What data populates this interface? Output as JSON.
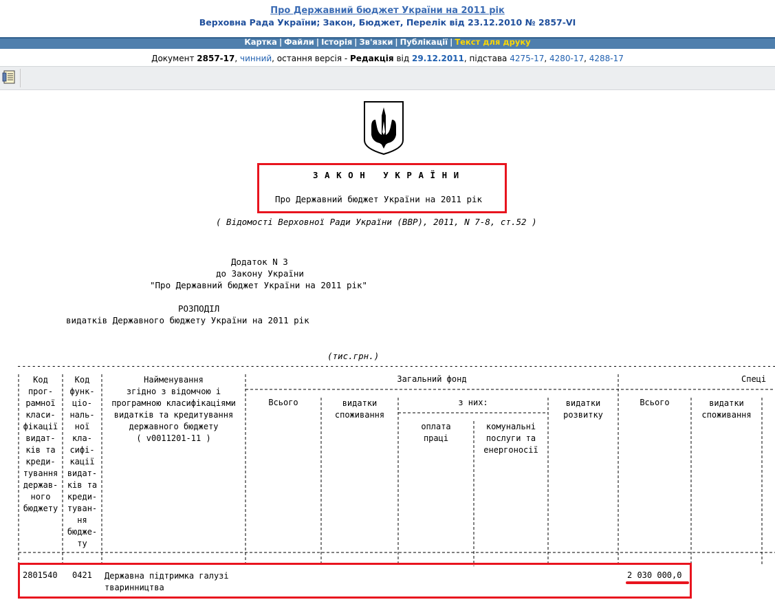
{
  "header": {
    "title_link": "Про Державний бюджет України на 2011 рік",
    "subtitle": "Верховна Рада України; Закон, Бюджет, Перелік від 23.12.2010 № 2857-VI"
  },
  "nav": {
    "items": [
      "Картка",
      "Файли",
      "Історія",
      "Зв'язки",
      "Публікації",
      "Текст для друку"
    ],
    "separator": "|"
  },
  "docline": {
    "prefix": "Документ",
    "number": "2857-17",
    "status": "чинний",
    "middle": ", остання версія -",
    "redaction_label": "Редакція",
    "from": "від",
    "date": "29.12.2011",
    "basis": ", підстава",
    "bases": [
      "4275-17",
      "4280-17",
      "4288-17"
    ]
  },
  "law": {
    "heading": "З А К О Н   У К Р А Ї Н И",
    "title": "Про Державний бюджет України на 2011 рік",
    "source": "( Відомості Верховної Ради України (ВВР), 2011, N 7-8, ст.52 )"
  },
  "appendix": {
    "line1": "Додаток N 3",
    "line2": "до Закону України",
    "line3": "\"Про Державний бюджет України на 2011 рік\"",
    "rozpodil": "РОЗПОДІЛ",
    "rozpodil_sub": "видатків Державного бюджету України на 2011 рік",
    "units": "(тис.грн.)"
  },
  "table": {
    "col_kod_prog": [
      "Код",
      "прог-",
      "рамної",
      "класи-",
      "фікації",
      "видат-",
      "ків та",
      "креди-",
      "тування",
      "держав-",
      "ного",
      "бюджету"
    ],
    "col_kod_func": [
      "Код",
      "функ-",
      "ціо-",
      "наль-",
      "ної",
      "кла-",
      "сифі-",
      "кації",
      "видат-",
      "ків та",
      "креди-",
      "туван-",
      "ня",
      "бюдже-",
      "ту"
    ],
    "col_name": [
      "Найменування",
      "згідно з відомчою і",
      "програмною класифікаціями",
      "видатків та кредитування",
      "державного бюджету",
      "( v0011201-11 )"
    ],
    "general_fund": "Загальний фонд",
    "special_fund": "Спеці",
    "vsogo": "Всього",
    "vydatky_spozhyvannia": [
      "видатки",
      "споживання"
    ],
    "z_nykh": "з них:",
    "oplata_pratsi": [
      "оплата",
      "праці"
    ],
    "komunalni": [
      "комунальні",
      "послуги та",
      "енергоносії"
    ],
    "vydatky_rozvytku": [
      "видатки",
      "розвитку"
    ],
    "row": {
      "kod_prog": "2801540",
      "kod_func": "0421",
      "name": [
        "Державна підтримка галузі",
        "тваринництва"
      ],
      "special_total": "2 030 000,0"
    }
  },
  "colors": {
    "link": "#3a6bb4",
    "nav_bg": "#4f7fad",
    "nav_active": "#ffd800",
    "highlight": "#e8141e"
  }
}
